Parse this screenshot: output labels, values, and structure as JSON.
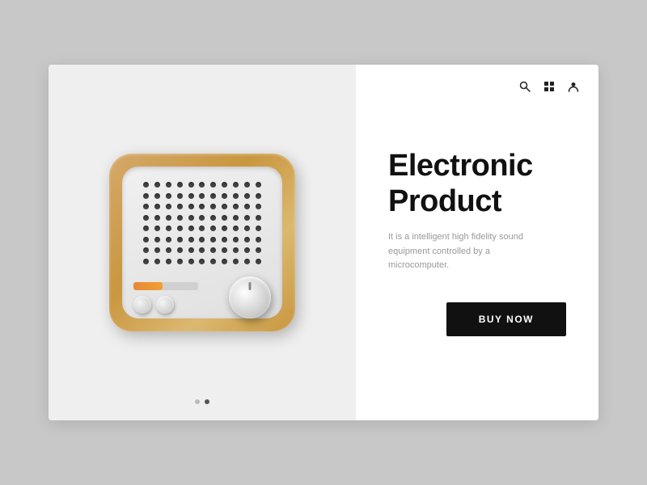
{
  "card": {
    "left": {
      "pagination": {
        "dots": [
          {
            "active": false
          },
          {
            "active": true
          }
        ]
      }
    },
    "right": {
      "icons": {
        "search_label": "search",
        "grid_label": "grid",
        "user_label": "user"
      },
      "title_line1": "Electronic",
      "title_line2": "Product",
      "description": "It is a intelligent high fidelity sound equipment controlled by a microcomputer.",
      "buy_button_label": "BUY NOW"
    }
  }
}
